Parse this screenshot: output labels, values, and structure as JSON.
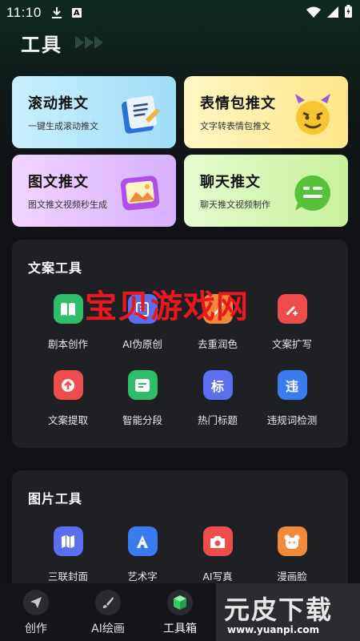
{
  "status_bar": {
    "time": "11:10",
    "a_icon": "A"
  },
  "header": {
    "title": "工具"
  },
  "cards": [
    {
      "title": "滚动推文",
      "subtitle": "一键生成滚动推文"
    },
    {
      "title": "表情包推文",
      "subtitle": "文字转表情包推文"
    },
    {
      "title": "图文推文",
      "subtitle": "图文推文视频秒生成"
    },
    {
      "title": "聊天推文",
      "subtitle": "聊天推文视频制作"
    }
  ],
  "copy_tools": {
    "title": "文案工具",
    "items": [
      {
        "label": "剧本创作",
        "icon": "book-icon",
        "color": "#2fbd6a"
      },
      {
        "label": "AI伪原创",
        "icon": "pen-icon",
        "color": "#5b6ef0"
      },
      {
        "label": "去重润色",
        "icon": "polish-icon",
        "color": "#f28a3a"
      },
      {
        "label": "文案扩写",
        "icon": "edit-plus-icon",
        "color": "#ef4d4d"
      },
      {
        "label": "文案提取",
        "icon": "upload-icon",
        "color": "#ef4d4d"
      },
      {
        "label": "智能分段",
        "icon": "paragraph-icon",
        "color": "#2fbd6a"
      },
      {
        "label": "热门标题",
        "icon_text": "标",
        "icon": "title-icon",
        "color": "#5b6ef0"
      },
      {
        "label": "违规词检测",
        "icon_text": "违",
        "icon": "violation-icon",
        "color": "#3a7cf0"
      }
    ]
  },
  "image_tools": {
    "title": "图片工具",
    "items": [
      {
        "label": "三联封面",
        "icon": "triptych-icon",
        "color": "#5b6ef0"
      },
      {
        "label": "艺术字",
        "icon": "art-text-icon",
        "color": "#3a7cf0"
      },
      {
        "label": "AI写真",
        "icon": "camera-icon",
        "color": "#ef4d4d"
      },
      {
        "label": "漫画脸",
        "icon": "bear-face-icon",
        "color": "#f28a3a"
      }
    ]
  },
  "watermark": "宝贝游戏网",
  "bottom_nav": [
    {
      "label": "创作",
      "icon": "paper-plane-icon"
    },
    {
      "label": "AI绘画",
      "icon": "brush-icon"
    },
    {
      "label": "工具箱",
      "icon": "cube-icon",
      "active": true
    }
  ],
  "brand": {
    "name": "元皮下载",
    "url": "www.yuanpi.com"
  }
}
